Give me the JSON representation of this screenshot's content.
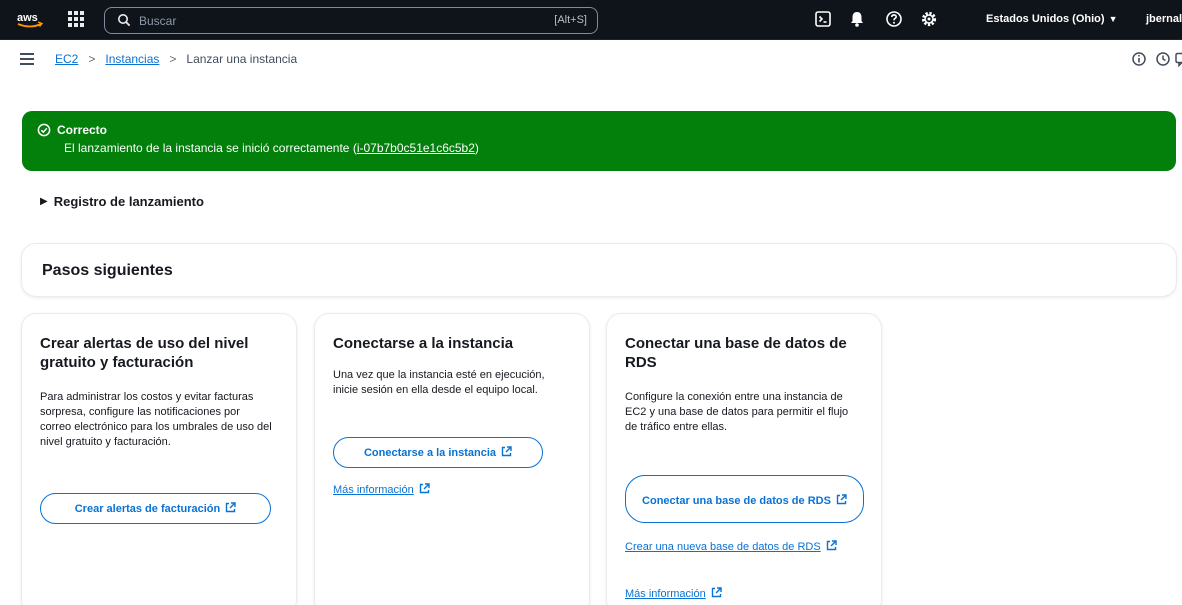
{
  "topnav": {
    "logo_text": "aws",
    "search_placeholder": "Buscar",
    "search_shortcut": "[Alt+S]",
    "region": "Estados Unidos (Ohio)",
    "user": "jbernal"
  },
  "breadcrumb": {
    "items": [
      {
        "label": "EC2"
      },
      {
        "label": "Instancias"
      },
      {
        "label": "Lanzar una instancia"
      }
    ]
  },
  "flash": {
    "title": "Correcto",
    "message": "El lanzamiento de la instancia se inició correctamente (",
    "instance_id": "i-07b7b0c51e1c6c5b2",
    "message_end": ")",
    "color": "#037f0c"
  },
  "launch_log": {
    "label": "Registro de lanzamiento"
  },
  "next_steps": {
    "title": "Pasos siguientes"
  },
  "cards": [
    {
      "title": "Crear alertas de uso del nivel gratuito y facturación",
      "body": "Para administrar los costos y evitar facturas sorpresa, configure las notificaciones por correo electrónico para los umbrales de uso del nivel gratuito y facturación.",
      "button": "Crear alertas de facturación"
    },
    {
      "title": "Conectarse a la instancia",
      "body": "Una vez que la instancia esté en ejecución, inicie sesión en ella desde el equipo local.",
      "button": "Conectarse a la instancia",
      "link": "Más información"
    },
    {
      "title": "Conectar una base de datos de RDS",
      "body": "Configure la conexión entre una instancia de EC2 y una base de datos para permitir el flujo de tráfico entre ellas.",
      "button": "Conectar una base de datos de RDS",
      "link1": "Crear una nueva base de datos de RDS",
      "link2": "Más información"
    }
  ],
  "colors": {
    "nav_bg": "#0f141a",
    "link": "#0972d3",
    "success": "#037f0c"
  }
}
